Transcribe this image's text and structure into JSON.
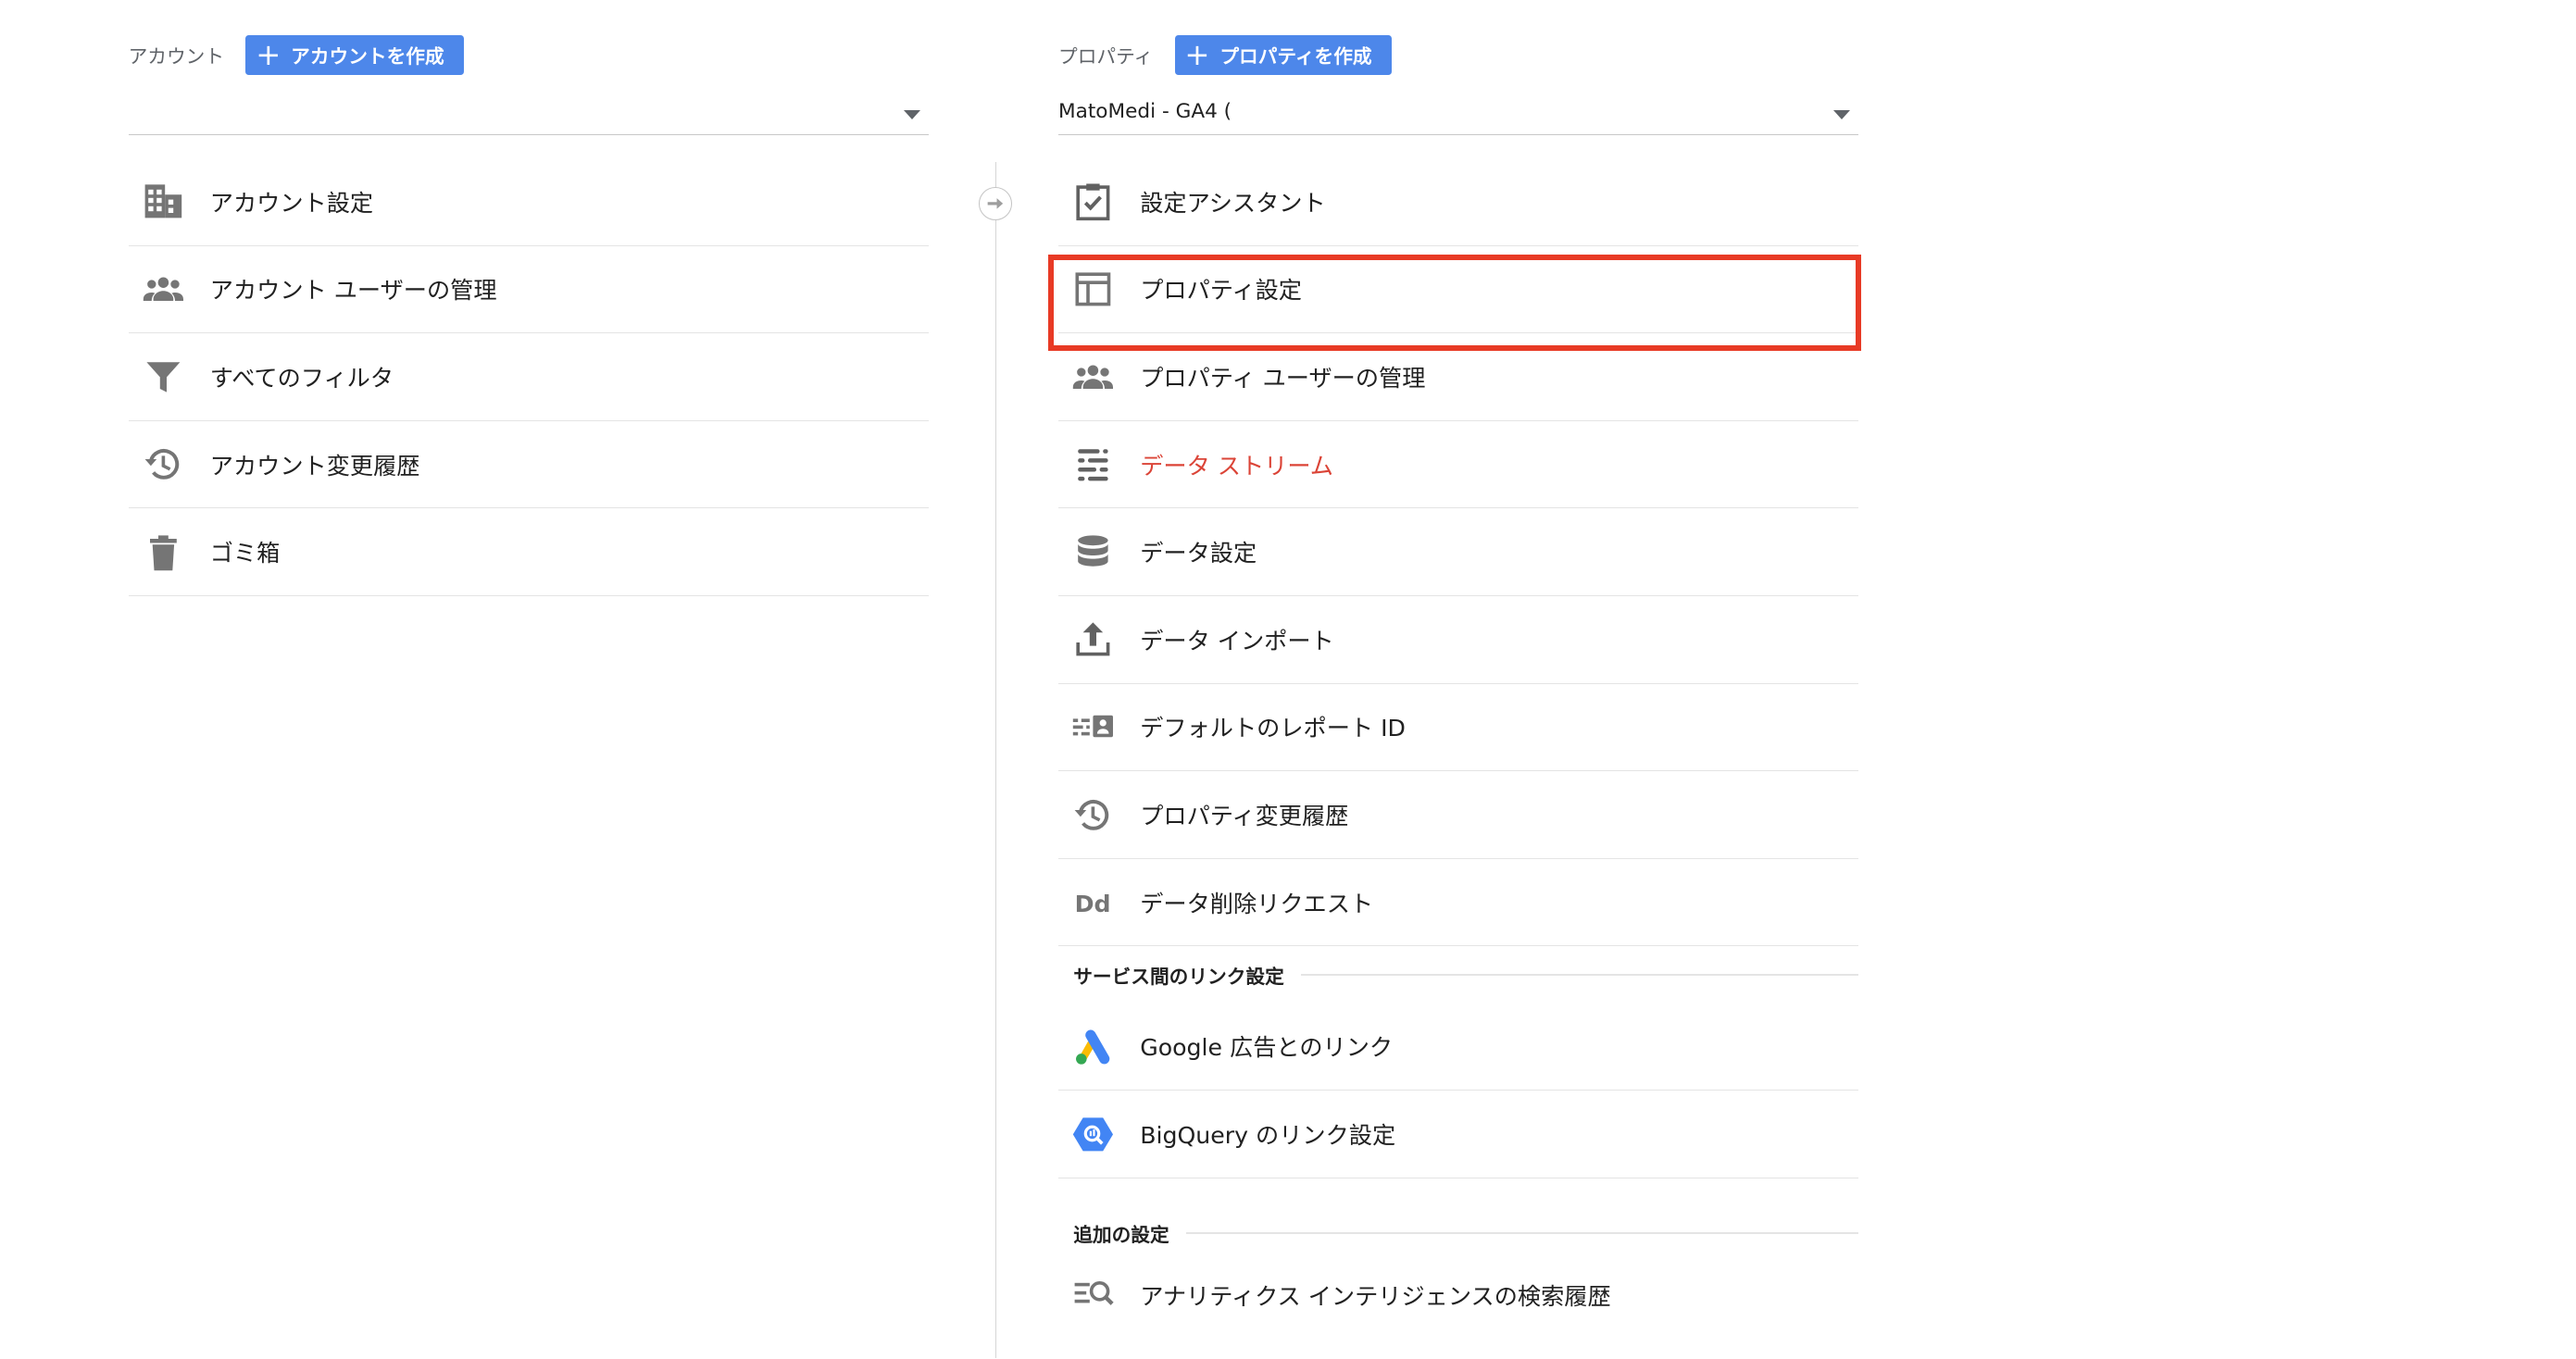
{
  "account": {
    "label": "アカウント",
    "create_button": "アカウントを作成",
    "selected": "",
    "items": [
      {
        "label": "アカウント設定",
        "icon": "building-icon"
      },
      {
        "label": "アカウント ユーザーの管理",
        "icon": "people-icon"
      },
      {
        "label": "すべてのフィルタ",
        "icon": "filter-icon"
      },
      {
        "label": "アカウント変更履歴",
        "icon": "history-icon"
      },
      {
        "label": "ゴミ箱",
        "icon": "trash-icon"
      }
    ]
  },
  "property": {
    "label": "プロパティ",
    "create_button": "プロパティを作成",
    "selected": "MatoMedi - GA4 (",
    "items": [
      {
        "label": "設定アシスタント",
        "icon": "checklist-icon"
      },
      {
        "label": "プロパティ設定",
        "icon": "layout-icon"
      },
      {
        "label": "プロパティ ユーザーの管理",
        "icon": "people-icon"
      },
      {
        "label": "データ ストリーム",
        "icon": "streams-icon"
      },
      {
        "label": "データ設定",
        "icon": "database-icon"
      },
      {
        "label": "データ インポート",
        "icon": "upload-icon"
      },
      {
        "label": "デフォルトのレポート ID",
        "icon": "report-id-icon"
      },
      {
        "label": "プロパティ変更履歴",
        "icon": "history-icon"
      },
      {
        "label": "データ削除リクエスト",
        "icon": "data-deletion-icon"
      }
    ],
    "link_section": {
      "title": "サービス間のリンク設定",
      "items": [
        {
          "label": "Google 広告とのリンク",
          "icon": "google-ads-icon"
        },
        {
          "label": "BigQuery のリンク設定",
          "icon": "bigquery-icon"
        }
      ]
    },
    "extra_section": {
      "title": "追加の設定",
      "items": [
        {
          "label": "アナリティクス インテリジェンスの検索履歴",
          "icon": "search-history-icon"
        }
      ]
    }
  },
  "colors": {
    "button_bg": "#4d87ea",
    "active_text": "#db4437",
    "highlight_border": "#e83a25",
    "icon_gray": "#757575"
  }
}
